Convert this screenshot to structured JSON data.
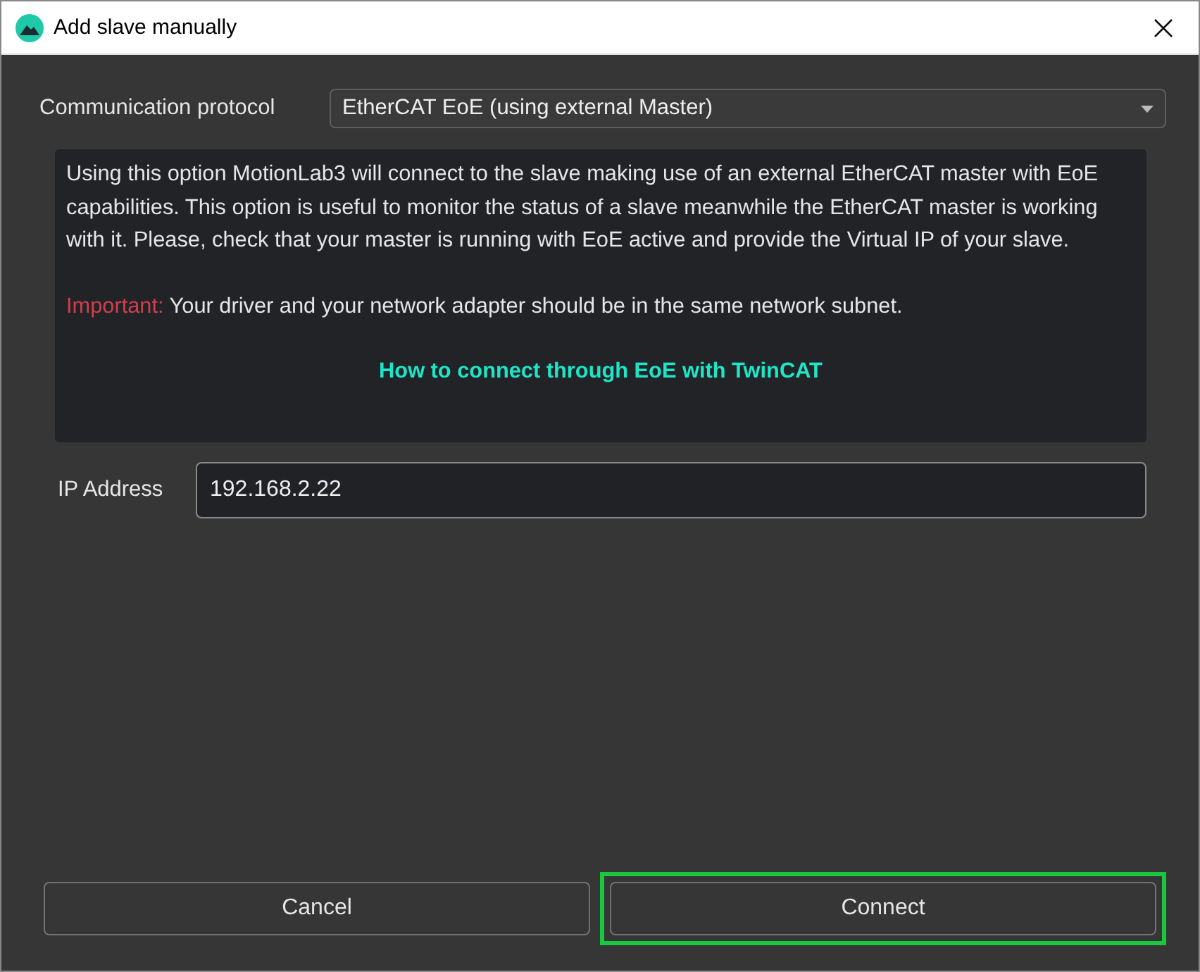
{
  "window": {
    "title": "Add slave manually"
  },
  "protocol": {
    "label": "Communication protocol",
    "value": "EtherCAT EoE (using external Master)"
  },
  "info": {
    "description": "Using this option MotionLab3 will connect to the slave making use of an external EtherCAT master with EoE capabilities. This option is useful to monitor the status of a slave meanwhile the EtherCAT master is working with it. Please, check that your master is running with EoE active and provide the Virtual IP of your slave.",
    "important_label": "Important:",
    "important_text": "Your driver and your network adapter should be in the same network subnet.",
    "link": "How to connect through EoE with TwinCAT"
  },
  "ip_address": {
    "label": "IP Address",
    "value": "192.168.2.22",
    "focused": true
  },
  "buttons": [
    {
      "label": "Cancel",
      "highlighted": false
    },
    {
      "label": "Connect",
      "highlighted": true
    }
  ]
}
